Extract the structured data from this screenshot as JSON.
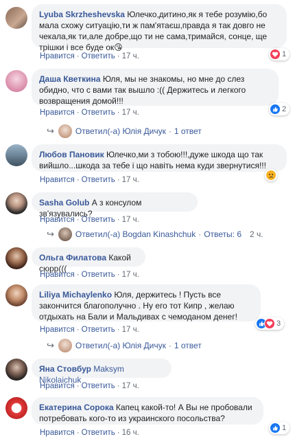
{
  "comments": [
    {
      "author": "Lyuba Skrzheshevska",
      "text": "Юлечко,дитино,як я тебе розумію,бо мала схожу ситуацію,ти ж пам'ятаєш,правда я так довго не чекала,як ти,але добре,що ти не сама,тримайся, сонце, ще трішки і все буде ок",
      "emoji": "😘",
      "like_label": "Нравится",
      "reply_label": "Ответить",
      "time": "17 ч.",
      "reaction_count": "1",
      "reaction_color": "#f33e58",
      "reaction_icon": "heart-icon"
    },
    {
      "author": "Даша Кветкина",
      "text": "Юля, мы не знакомы, но мне до слез обидно, что с вами так вышло :(( Держитесь и легкого возвращения домой!!!",
      "like_label": "Нравится",
      "reply_label": "Ответить",
      "time": "17 ч.",
      "reaction_count": "2",
      "reaction_color": "#1877f2",
      "reaction_icon": "like-icon",
      "replies": {
        "text": "Ответил(-а) Юлія Дичук",
        "count": "1 ответ"
      }
    },
    {
      "author": "Любов Пановик",
      "text": "Юлечко,ми з тобою!!!,дуже шкода що так вийшло...шкода за тебе і що навіть нема куди звернутися!!!",
      "like_label": "Нравится",
      "reply_label": "Ответить",
      "time": "17 ч.",
      "reaction_color": "#f7b125",
      "reaction_icon": "sad-icon"
    },
    {
      "author": "Sasha Golub",
      "text": "А з консулом зв'язувались?",
      "like_label": "Нравится",
      "reply_label": "Ответить",
      "time": "17 ч.",
      "replies": {
        "text": "Ответил(-а) Bogdan Kinashchuk",
        "count": "Ответы: 6",
        "time": "2 ч."
      }
    },
    {
      "author": "Ольга Филатова",
      "text": "Какой сюрр(((",
      "like_label": "Нравится",
      "reply_label": "Ответить",
      "time": "17 ч."
    },
    {
      "author": "Liliya Michaylenko",
      "text": "Юля, держитесь ! Пусть все закончится благополучно . Ну его тот Кипр , желаю отдыхать на Бали и Мальдивах с чемоданом денег!",
      "like_label": "Нравится",
      "reply_label": "Ответить",
      "time": "17 ч.",
      "reaction_count": "3",
      "reaction_colors": [
        "#1877f2",
        "#f33e58"
      ],
      "replies": {
        "text": "Ответил(-а) Юлія Дичук",
        "count": "1 ответ"
      }
    },
    {
      "author": "Яна Стовбур",
      "mention": "Maksym Nikolaichuk",
      "like_label": "Нравится",
      "reply_label": "Ответить",
      "time": "17 ч."
    },
    {
      "author": "Екатерина Сорока",
      "text": "Капец какой-то! А Вы не пробовали потребовать кого-то из украинского посольства?",
      "like_label": "Нравится",
      "reply_label": "Ответить",
      "time": "16 ч.",
      "reaction_count": "1",
      "reaction_color": "#1877f2",
      "reaction_icon": "like-icon"
    }
  ],
  "colors": {
    "link": "#385898",
    "bubble": "#f2f3f5",
    "meta": "#606770"
  }
}
